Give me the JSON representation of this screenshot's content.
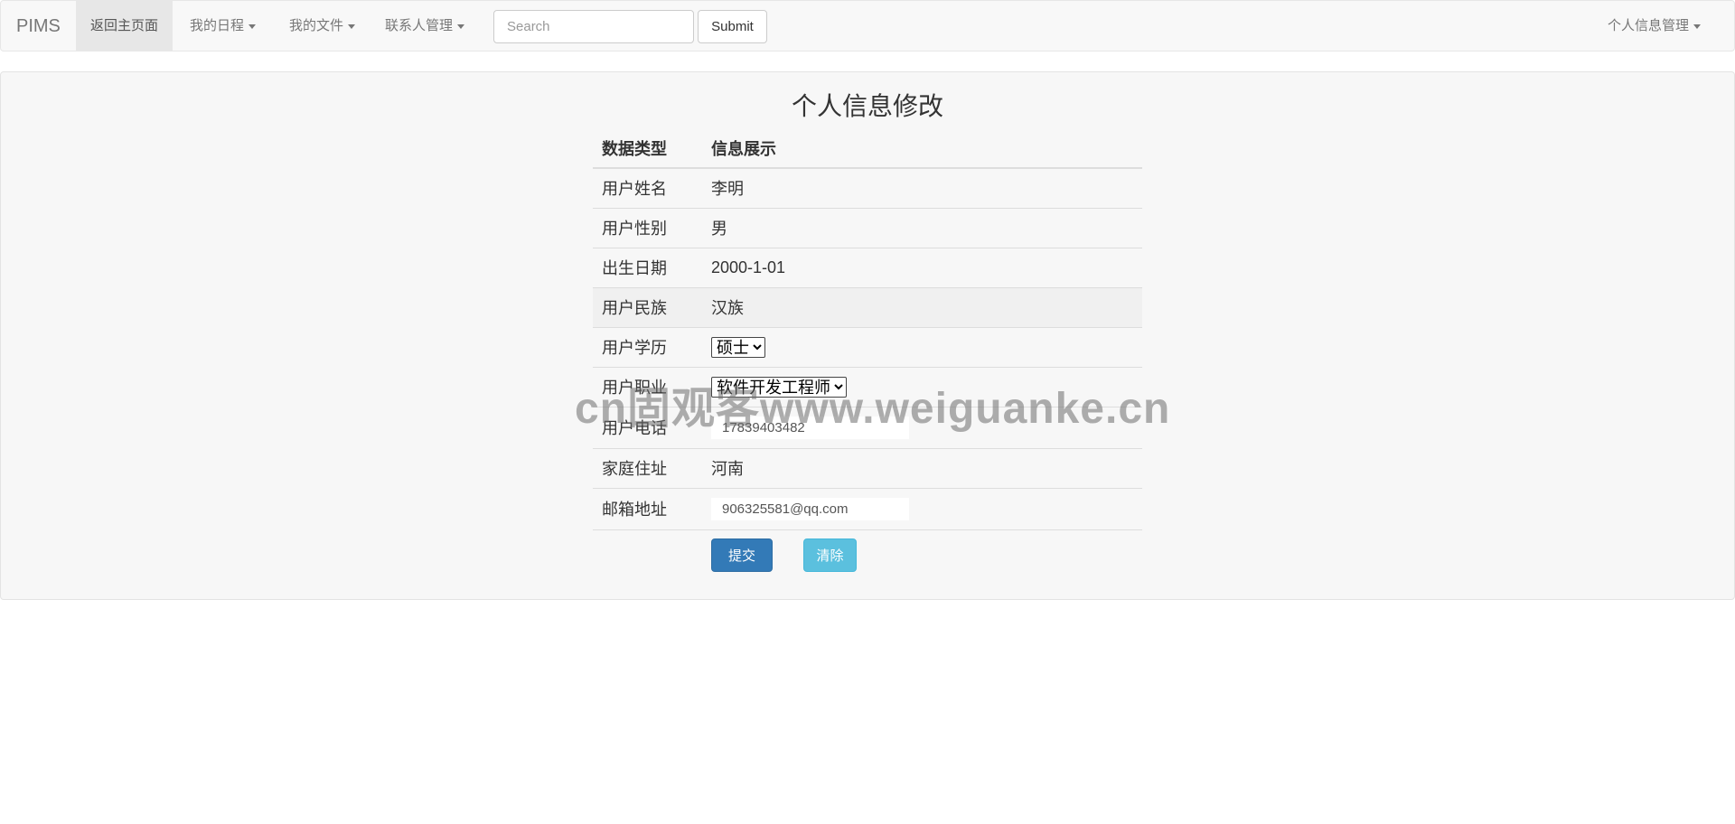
{
  "navbar": {
    "brand": "PIMS",
    "items": [
      {
        "label": "返回主页面"
      },
      {
        "label": "我的日程"
      },
      {
        "label": "我的文件"
      },
      {
        "label": "联系人管理"
      }
    ],
    "search_placeholder": "Search",
    "submit_label": "Submit",
    "right_menu": "个人信息管理"
  },
  "form": {
    "title": "个人信息修改",
    "headers": [
      "数据类型",
      "信息展示"
    ],
    "rows": [
      {
        "label": "用户姓名",
        "value": "李明"
      },
      {
        "label": "用户性别",
        "value": "男"
      },
      {
        "label": "出生日期",
        "value": "2000-1-01"
      },
      {
        "label": "用户民族",
        "value": "汉族"
      },
      {
        "label": "用户学历",
        "value": "硕士"
      },
      {
        "label": "用户职业",
        "value": "软件开发工程师"
      },
      {
        "label": "用户电话",
        "value": "17839403482"
      },
      {
        "label": "家庭住址",
        "value": "河南"
      },
      {
        "label": "邮箱地址",
        "value": "906325581@qq.com"
      }
    ],
    "submit_button": "提交",
    "clear_button": "清除"
  },
  "watermark": "cn固观客www.weiguanke.cn",
  "colors": {
    "primary": "#337ab7",
    "info": "#5bc0de",
    "navbar_bg": "#f8f8f8"
  }
}
